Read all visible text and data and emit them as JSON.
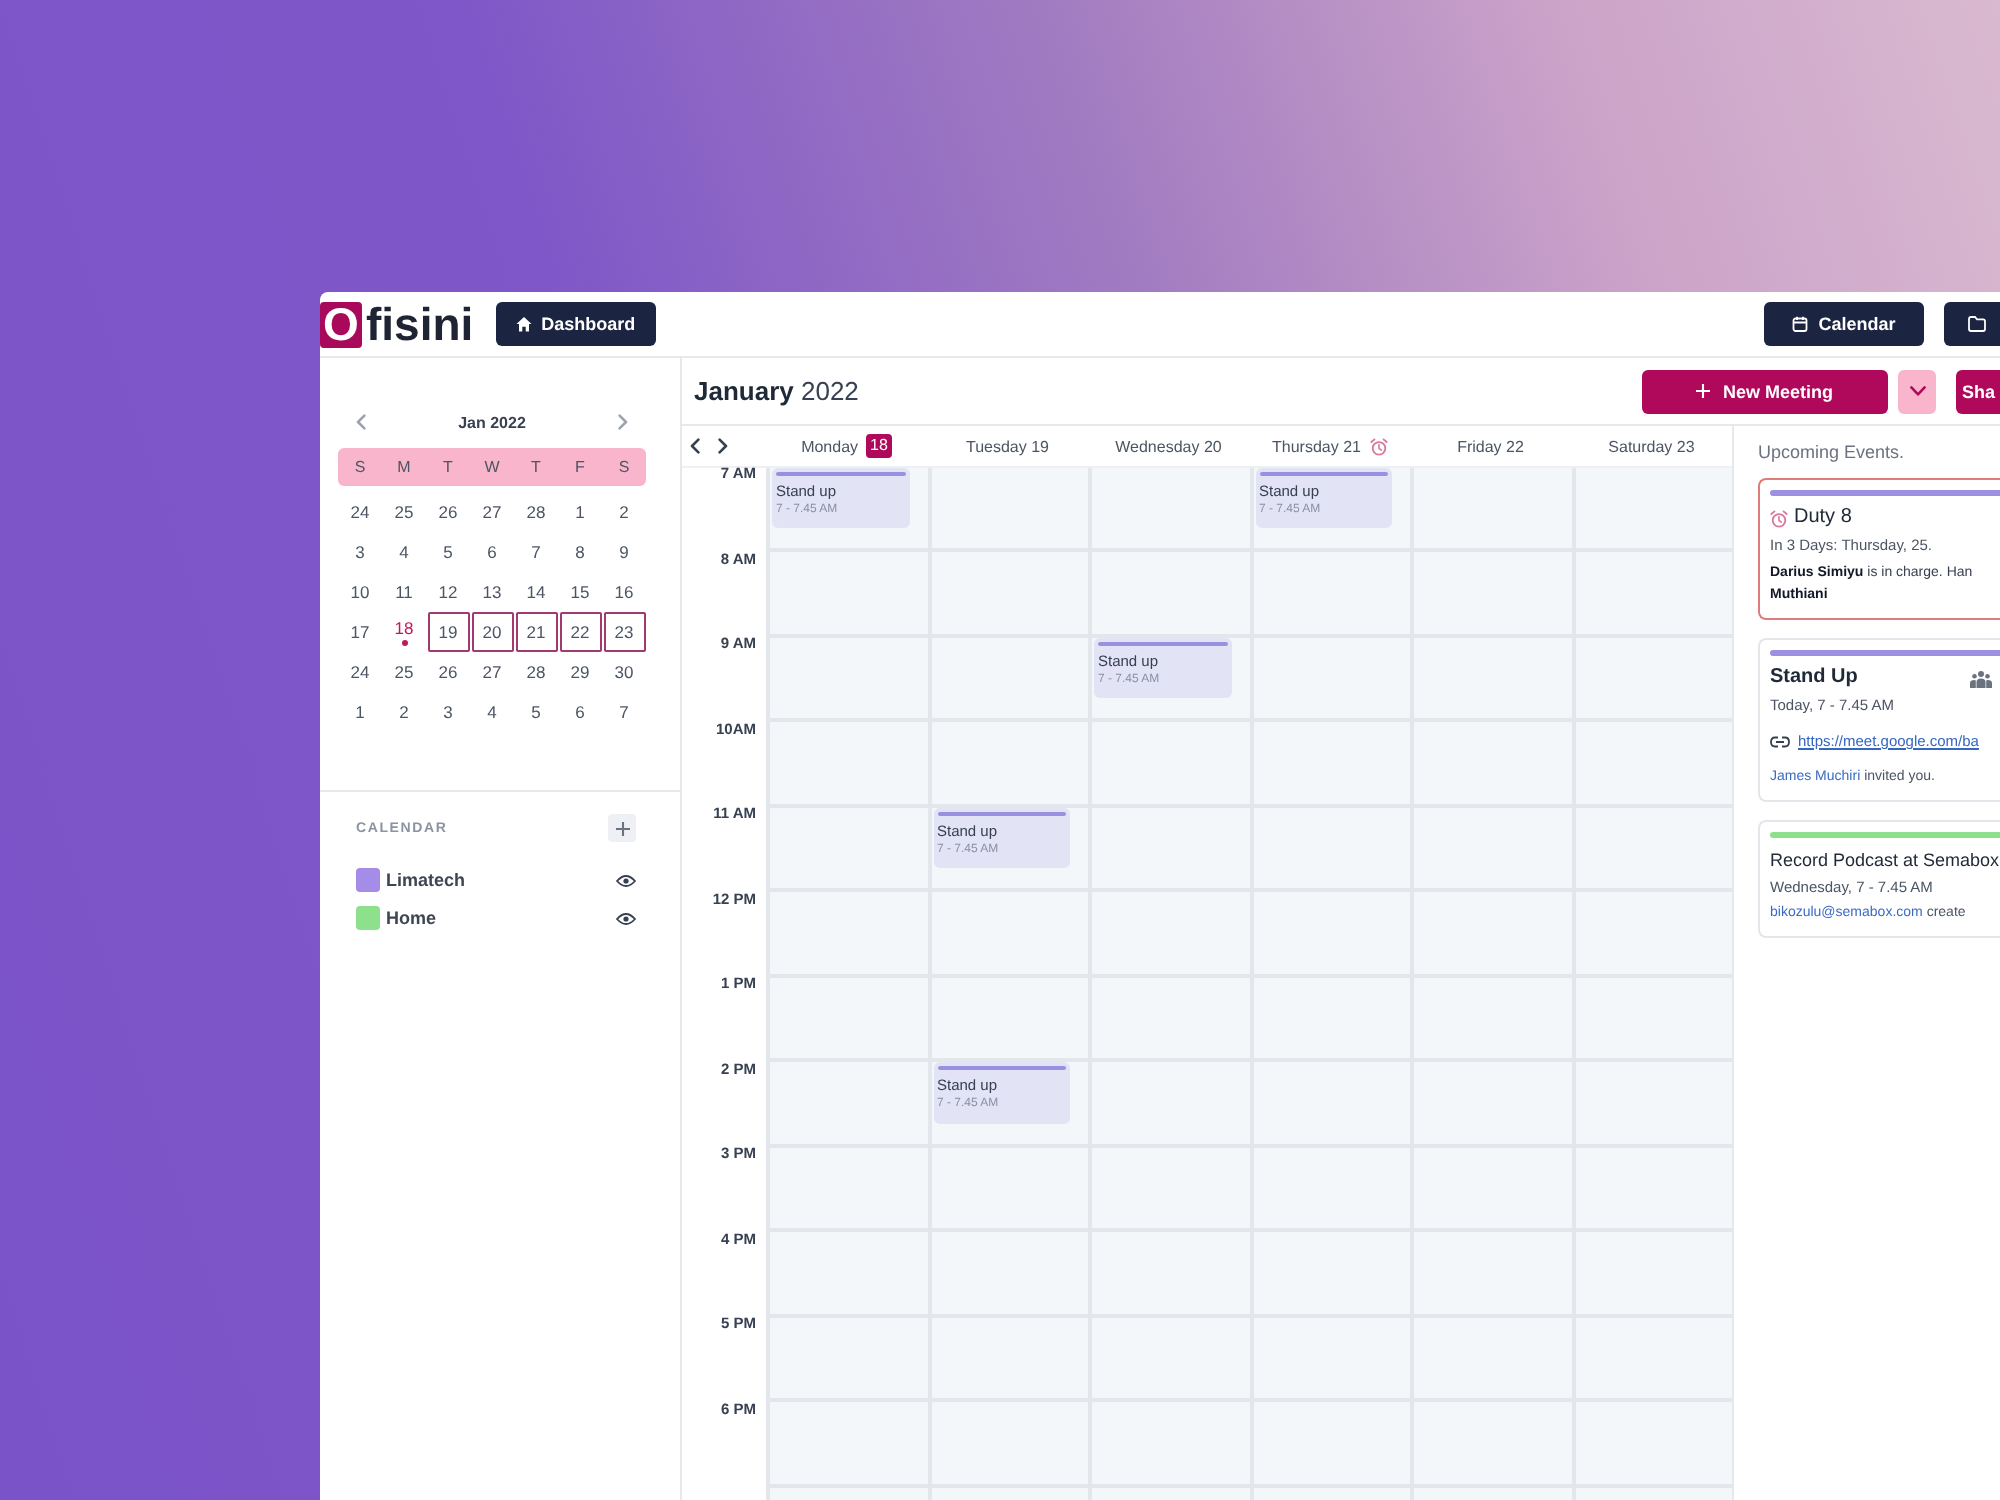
{
  "topbar": {
    "logo_mark": "O",
    "logo_text": "fisini",
    "dashboard_button": "Dashboard",
    "calendar_button": "Calendar"
  },
  "mini_calendar": {
    "month": "Jan 2022",
    "weekdays": [
      "S",
      "M",
      "T",
      "W",
      "T",
      "F",
      "S"
    ],
    "weeks": [
      [
        {
          "label": "24",
          "selected": false,
          "today": false
        },
        {
          "label": "25",
          "selected": false,
          "today": false
        },
        {
          "label": "26",
          "selected": false,
          "today": false
        },
        {
          "label": "27",
          "selected": false,
          "today": false
        },
        {
          "label": "28",
          "selected": false,
          "today": false
        },
        {
          "label": "1",
          "selected": false,
          "today": false
        },
        {
          "label": "2",
          "selected": false,
          "today": false
        }
      ],
      [
        {
          "label": "3",
          "selected": false,
          "today": false
        },
        {
          "label": "4",
          "selected": false,
          "today": false
        },
        {
          "label": "5",
          "selected": false,
          "today": false
        },
        {
          "label": "6",
          "selected": false,
          "today": false
        },
        {
          "label": "7",
          "selected": false,
          "today": false
        },
        {
          "label": "8",
          "selected": false,
          "today": false
        },
        {
          "label": "9",
          "selected": false,
          "today": false
        }
      ],
      [
        {
          "label": "10",
          "selected": false,
          "today": false
        },
        {
          "label": "11",
          "selected": false,
          "today": false
        },
        {
          "label": "12",
          "selected": false,
          "today": false
        },
        {
          "label": "13",
          "selected": false,
          "today": false
        },
        {
          "label": "14",
          "selected": false,
          "today": false
        },
        {
          "label": "15",
          "selected": false,
          "today": false
        },
        {
          "label": "16",
          "selected": false,
          "today": false
        }
      ],
      [
        {
          "label": "17",
          "selected": false,
          "today": false
        },
        {
          "label": "18",
          "selected": false,
          "today": true
        },
        {
          "label": "19",
          "selected": true,
          "today": false
        },
        {
          "label": "20",
          "selected": true,
          "today": false
        },
        {
          "label": "21",
          "selected": true,
          "today": false
        },
        {
          "label": "22",
          "selected": true,
          "today": false
        },
        {
          "label": "23",
          "selected": true,
          "today": false
        }
      ],
      [
        {
          "label": "24",
          "selected": false,
          "today": false
        },
        {
          "label": "25",
          "selected": false,
          "today": false
        },
        {
          "label": "26",
          "selected": false,
          "today": false
        },
        {
          "label": "27",
          "selected": false,
          "today": false
        },
        {
          "label": "28",
          "selected": false,
          "today": false
        },
        {
          "label": "29",
          "selected": false,
          "today": false
        },
        {
          "label": "30",
          "selected": false,
          "today": false
        }
      ],
      [
        {
          "label": "1",
          "selected": false,
          "today": false
        },
        {
          "label": "2",
          "selected": false,
          "today": false
        },
        {
          "label": "3",
          "selected": false,
          "today": false
        },
        {
          "label": "4",
          "selected": false,
          "today": false
        },
        {
          "label": "5",
          "selected": false,
          "today": false
        },
        {
          "label": "6",
          "selected": false,
          "today": false
        },
        {
          "label": "7",
          "selected": false,
          "today": false
        }
      ]
    ]
  },
  "calendars": {
    "heading": "CALENDAR",
    "items": [
      {
        "name": "Limatech",
        "color": "#a48ce8",
        "visible": true
      },
      {
        "name": "Home",
        "color": "#8de08c",
        "visible": true
      }
    ]
  },
  "header": {
    "title": "**January** 2022",
    "new_meeting_button": "New Meeting",
    "share_button": "Sha"
  },
  "days": [
    {
      "name": "Monday",
      "date": "18",
      "today": true,
      "reminder": false
    },
    {
      "name": "Tuesday",
      "date": "19",
      "today": false,
      "reminder": false
    },
    {
      "name": "Wednesday",
      "date": "20",
      "today": false,
      "reminder": false
    },
    {
      "name": "Thursday",
      "date": "21",
      "today": false,
      "reminder": true
    },
    {
      "name": "Friday",
      "date": "22",
      "today": false,
      "reminder": false
    },
    {
      "name": "Saturday",
      "date": "23",
      "today": false,
      "reminder": false
    }
  ],
  "time_grid": {
    "rows": [
      {
        "time": "7 AM",
        "cells": [
          {
            "title": "Stand up",
            "time": "7 - 7.45 AM"
          },
          null,
          null,
          {
            "title": "Stand up",
            "time": "7 - 7.45 AM"
          },
          null,
          null
        ]
      },
      {
        "time": "8 AM",
        "cells": [
          null,
          null,
          null,
          null,
          null,
          null
        ]
      },
      {
        "time": "9 AM",
        "cells": [
          null,
          null,
          {
            "title": "Stand up",
            "time": "7 - 7.45 AM"
          },
          null,
          null,
          null
        ]
      },
      {
        "time": "10AM",
        "cells": [
          null,
          null,
          null,
          null,
          null,
          null
        ]
      },
      {
        "time": "11 AM",
        "cells": [
          null,
          {
            "title": "Stand up",
            "time": "7 - 7.45 AM"
          },
          null,
          null,
          null,
          null
        ]
      },
      {
        "time": "12 PM",
        "cells": [
          null,
          null,
          null,
          null,
          null,
          null
        ]
      },
      {
        "time": "1 PM",
        "cells": [
          null,
          null,
          null,
          null,
          null,
          null
        ]
      },
      {
        "time": "2 PM",
        "cells": [
          null,
          {
            "title": "Stand up",
            "time": "7 - 7.45 AM"
          },
          null,
          null,
          null,
          null
        ]
      },
      {
        "time": "3 PM",
        "cells": [
          null,
          null,
          null,
          null,
          null,
          null
        ]
      },
      {
        "time": "4 PM",
        "cells": [
          null,
          null,
          null,
          null,
          null,
          null
        ]
      },
      {
        "time": "5 PM",
        "cells": [
          null,
          null,
          null,
          null,
          null,
          null
        ]
      },
      {
        "time": "6 PM",
        "cells": [
          null,
          null,
          null,
          null,
          null,
          null
        ]
      }
    ]
  },
  "upcoming": {
    "heading": "Upcoming Events.",
    "cards": [
      {
        "kind": "reminder",
        "urgent": true,
        "color": "#9d90e2",
        "title": "Duty 8",
        "subtitle": "In 3 Days: Thursday, 25.",
        "note_lines": [
          "**Darius Simiyu** is in charge. Han",
          "**Muthiani**"
        ]
      },
      {
        "kind": "meeting",
        "urgent": false,
        "color": "#9d90e2",
        "title": "Stand Up",
        "subtitle": "Today, 7 - 7.45 AM",
        "link": "https://meet.google.com/ba",
        "by": {
          "name": "James Muchiri",
          "text": "invited you."
        }
      },
      {
        "kind": "event",
        "urgent": false,
        "color": "#8ee08f",
        "title": "Record Podcast at Semabox",
        "subtitle": "Wednesday, 7 - 7.45 AM",
        "by": {
          "name": "bikozulu@semabox.com",
          "text": "create"
        }
      }
    ]
  }
}
